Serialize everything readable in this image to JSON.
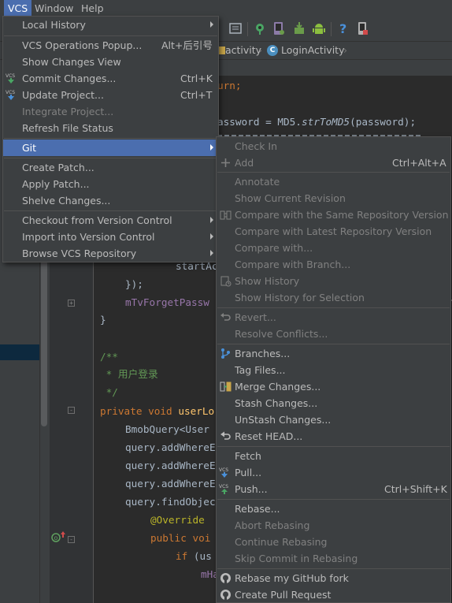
{
  "menubar": {
    "vcs": "VCS",
    "window": "Window",
    "help": "Help"
  },
  "breadcrumbs": {
    "item1": "activity",
    "item2": "LoginActivity",
    "class_badge": "C"
  },
  "code_lines": {
    "l1": "urn;",
    "l2_a": "assword = MD5.",
    "l2_b": "strToMD5",
    "l2_c": "(password);",
    "l3": "startAc",
    "l4": "});",
    "l5": "mTvForgetPassw",
    "l6": "}",
    "l7": "/**",
    "l8": " * 用户登录",
    "l9": " */",
    "l10_kw": "private void ",
    "l10_name": "userLo",
    "l11": "BmobQuery<User",
    "l12": "query.addWhereE",
    "l13": "query.addWhereE",
    "l14": "query.addWhereE",
    "l15": "query.findObjec",
    "l16": "@Override",
    "l17": "public voi",
    "l18_kw": "if",
    "l18_rest": " (us",
    "l19": "mHa"
  },
  "vcs_menu": {
    "local_history": "Local History",
    "ops_popup": "VCS Operations Popup...",
    "ops_popup_sc": "Alt+后引号",
    "show_changes": "Show Changes View",
    "commit": "Commit Changes...",
    "commit_sc": "Ctrl+K",
    "update": "Update Project...",
    "update_sc": "Ctrl+T",
    "integrate": "Integrate Project...",
    "refresh": "Refresh File Status",
    "git": "Git",
    "create_patch": "Create Patch...",
    "apply_patch": "Apply Patch...",
    "shelve": "Shelve Changes...",
    "checkout": "Checkout from Version Control",
    "import": "Import into Version Control",
    "browse": "Browse VCS Repository"
  },
  "git_menu": {
    "check_in": "Check In",
    "add": "Add",
    "add_sc": "Ctrl+Alt+A",
    "annotate": "Annotate",
    "show_current_revision": "Show Current Revision",
    "compare_same_repo": "Compare with the Same Repository Version",
    "compare_latest_repo": "Compare with Latest Repository Version",
    "compare_with": "Compare with...",
    "compare_branch": "Compare with Branch...",
    "show_history": "Show History",
    "show_history_selection": "Show History for Selection",
    "revert": "Revert...",
    "resolve_conflicts": "Resolve Conflicts...",
    "branches": "Branches...",
    "tag_files": "Tag Files...",
    "merge_changes": "Merge Changes...",
    "stash_changes": "Stash Changes...",
    "unstash_changes": "UnStash Changes...",
    "reset_head": "Reset HEAD...",
    "fetch": "Fetch",
    "pull": "Pull...",
    "push": "Push...",
    "push_sc": "Ctrl+Shift+K",
    "rebase": "Rebase...",
    "abort_rebasing": "Abort Rebasing",
    "continue_rebasing": "Continue Rebasing",
    "skip_commit": "Skip Commit in Rebasing",
    "rebase_github_fork": "Rebase my GitHub fork",
    "create_pull_request": "Create Pull Request"
  },
  "colors": {
    "selection": "#4b6eaf",
    "menu_bg": "#3c3f41",
    "editor_bg": "#2b2b2b"
  }
}
